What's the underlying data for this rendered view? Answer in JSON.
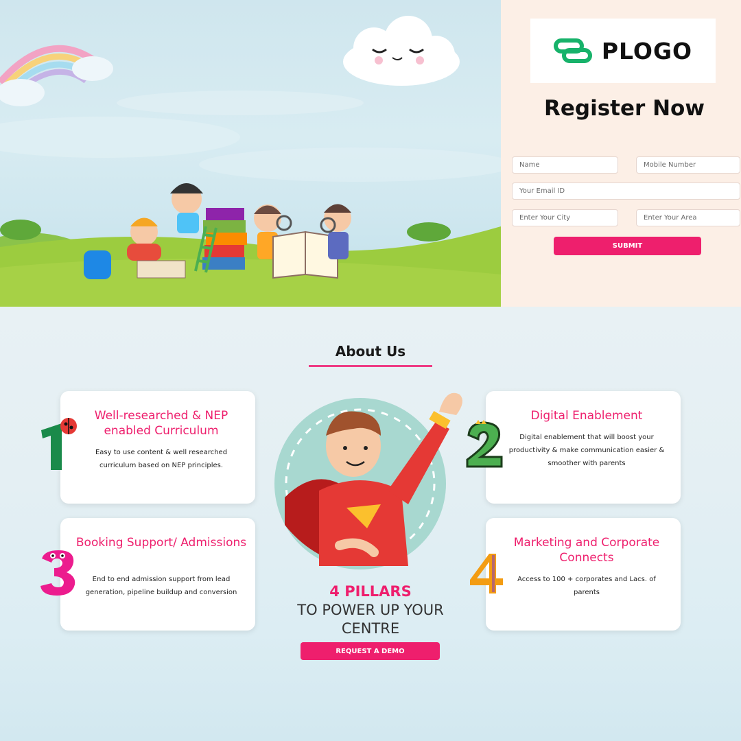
{
  "brand": {
    "name": "PLOGO",
    "logo_icon": "interlocked-ring-logo-icon",
    "accent": "#17b26a"
  },
  "register": {
    "title": "Register Now",
    "fields": {
      "name": "Name",
      "mobile": "Mobile Number",
      "email": "Your Email ID",
      "city": "Enter Your City",
      "area": "Enter Your Area"
    },
    "submit_label": "SUBMIT"
  },
  "about": {
    "title": "About Us",
    "cards": [
      {
        "number": "1",
        "title": "Well-researched & NEP enabled Curriculum",
        "body": "Easy to use content & well researched curriculum based on NEP principles."
      },
      {
        "number": "2",
        "title": "Digital Enablement",
        "body": "Digital enablement that will boost your productivity & make communication easier & smoother with parents"
      },
      {
        "number": "3",
        "title": "Booking Support/ Admissions",
        "body": "End to end admission support from lead generation, pipeline buildup and conversion"
      },
      {
        "number": "4",
        "title": "Marketing and Corporate Connects",
        "body": "Access to 100 + corporates and Lacs. of parents"
      }
    ],
    "pillars_line1": "4 PILLARS",
    "pillars_line2": "TO POWER UP YOUR",
    "pillars_line3": "CENTRE",
    "demo_label": "REQUEST A DEMO"
  },
  "colors": {
    "primary": "#ee1f6d",
    "register_bg": "#fcefe6"
  }
}
